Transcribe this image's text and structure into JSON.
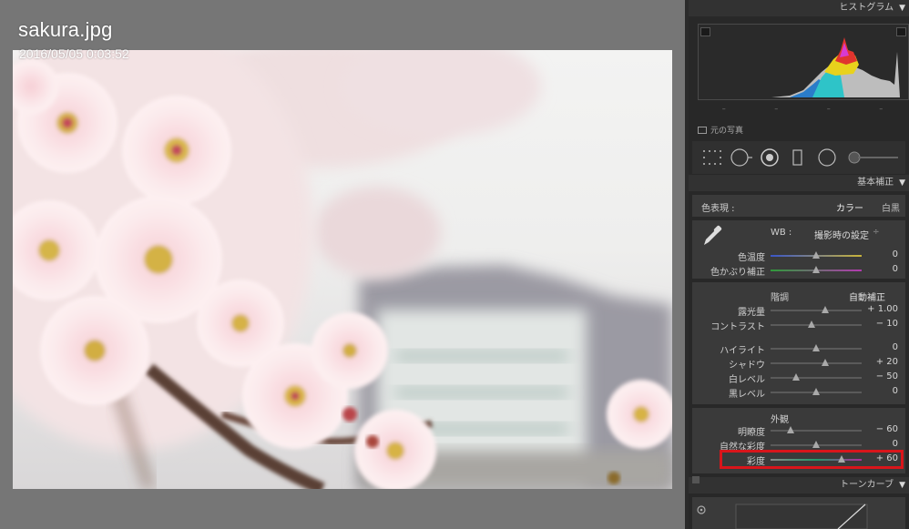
{
  "photo": {
    "filename": "sakura.jpg",
    "datetime": "2016/05/05 0:03:52"
  },
  "histogram_panel": {
    "title": "ヒストグラム",
    "original_photo_label": "元の写真"
  },
  "basic_panel": {
    "title": "基本補正",
    "treatment_label": "色表現 :",
    "treatment_color": "カラー",
    "treatment_bw": "白黒",
    "wb_label": "WB :",
    "wb_value": "撮影時の設定",
    "wb_arrows": "÷",
    "tone_label": "階調",
    "auto_label": "自動補正",
    "presence_label": "外観",
    "sliders": [
      {
        "label": "色温度",
        "value": "0",
        "position": 0.5
      },
      {
        "label": "色かぶり補正",
        "value": "0",
        "position": 0.5
      },
      {
        "label": "露光量",
        "value": "+ 1.00",
        "position": 0.6
      },
      {
        "label": "コントラスト",
        "value": "− 10",
        "position": 0.45
      },
      {
        "label": "ハイライト",
        "value": "0",
        "position": 0.5
      },
      {
        "label": "シャドウ",
        "value": "+ 20",
        "position": 0.6
      },
      {
        "label": "白レベル",
        "value": "− 50",
        "position": 0.28
      },
      {
        "label": "黒レベル",
        "value": "0",
        "position": 0.5
      },
      {
        "label": "明瞭度",
        "value": "− 60",
        "position": 0.22
      },
      {
        "label": "自然な彩度",
        "value": "0",
        "position": 0.5
      },
      {
        "label": "彩度",
        "value": "+ 60",
        "position": 0.78
      }
    ]
  },
  "tone_curve_panel": {
    "title": "トーンカーブ"
  },
  "colors": {
    "highlight": "#d9151b",
    "panel_bg": "#282828"
  }
}
